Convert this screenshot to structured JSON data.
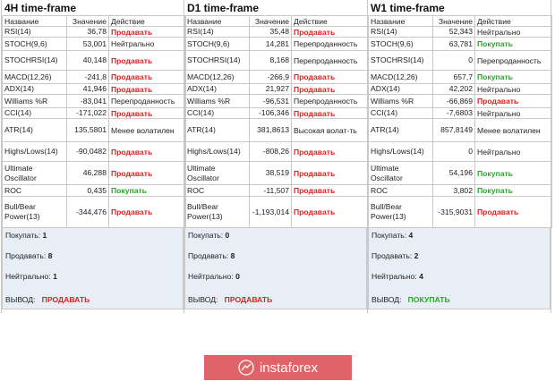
{
  "frames": [
    {
      "title": "4H time-frame",
      "headers": {
        "name": "Название",
        "value": "Значение",
        "action": "Действие"
      },
      "rows": [
        {
          "name": "RSI(14)",
          "value": "36,78",
          "action": "Продавать",
          "type": "sell"
        },
        {
          "name": "STOCH(9,6)",
          "value": "53,001",
          "action": "Нейтрально",
          "type": "neutral"
        },
        {
          "name": "STOCHRSI(14)",
          "value": "40,148",
          "action": "Продавать",
          "type": "sell"
        },
        {
          "name": "MACD(12,26)",
          "value": "-241,8",
          "action": "Продавать",
          "type": "sell"
        },
        {
          "name": "ADX(14)",
          "value": "41,946",
          "action": "Продавать",
          "type": "sell"
        },
        {
          "name": "Williams %R",
          "value": "-83,041",
          "action": "Перепроданность",
          "type": "neutral"
        },
        {
          "name": "CCI(14)",
          "value": "-171,022",
          "action": "Продавать",
          "type": "sell"
        },
        {
          "name": "ATR(14)",
          "value": "135,5801",
          "action": "Менее волатилен",
          "type": "neutral"
        },
        {
          "name": "Highs/Lows(14)",
          "value": "-90,0482",
          "action": "Продавать",
          "type": "sell"
        },
        {
          "name": "Ultimate Oscillator",
          "value": "46,288",
          "action": "Продавать",
          "type": "sell"
        },
        {
          "name": "ROC",
          "value": "0,435",
          "action": "Покупать",
          "type": "buy"
        },
        {
          "name": "Bull/Bear Power(13)",
          "value": "-344,476",
          "action": "Продавать",
          "type": "sell"
        }
      ],
      "summary": {
        "buy_label": "Покупать:",
        "buy": "1",
        "sell_label": "Продавать:",
        "sell": "8",
        "neutral_label": "Нейтрально:",
        "neutral": "1",
        "verdict_label": "ВЫВОД:",
        "verdict": "ПРОДАВАТЬ",
        "verdict_type": "sell"
      }
    },
    {
      "title": "D1 time-frame",
      "headers": {
        "name": "Название",
        "value": "Значение",
        "action": "Действие"
      },
      "rows": [
        {
          "name": "RSI(14)",
          "value": "35,48",
          "action": "Продавать",
          "type": "sell"
        },
        {
          "name": "STOCH(9,6)",
          "value": "14,281",
          "action": "Перепроданность",
          "type": "neutral"
        },
        {
          "name": "STOCHRSI(14)",
          "value": "8,168",
          "action": "Перепроданность",
          "type": "neutral"
        },
        {
          "name": "MACD(12,26)",
          "value": "-266,9",
          "action": "Продавать",
          "type": "sell"
        },
        {
          "name": "ADX(14)",
          "value": "21,927",
          "action": "Продавать",
          "type": "sell"
        },
        {
          "name": "Williams %R",
          "value": "-96,531",
          "action": "Перепроданность",
          "type": "neutral"
        },
        {
          "name": "CCI(14)",
          "value": "-106,346",
          "action": "Продавать",
          "type": "sell"
        },
        {
          "name": "ATR(14)",
          "value": "381,8613",
          "action": "Высокая волат-ть",
          "type": "neutral"
        },
        {
          "name": "Highs/Lows(14)",
          "value": "-808,26",
          "action": "Продавать",
          "type": "sell"
        },
        {
          "name": "Ultimate Oscillator",
          "value": "38,519",
          "action": "Продавать",
          "type": "sell"
        },
        {
          "name": "ROC",
          "value": "-11,507",
          "action": "Продавать",
          "type": "sell"
        },
        {
          "name": "Bull/Bear Power(13)",
          "value": "-1,193,014",
          "action": "Продавать",
          "type": "sell"
        }
      ],
      "summary": {
        "buy_label": "Покупать:",
        "buy": "0",
        "sell_label": "Продавать:",
        "sell": "8",
        "neutral_label": "Нейтрально:",
        "neutral": "0",
        "verdict_label": "ВЫВОД:",
        "verdict": "ПРОДАВАТЬ",
        "verdict_type": "sell"
      }
    },
    {
      "title": "W1 time-frame",
      "headers": {
        "name": "Название",
        "value": "Значение",
        "action": "Действие"
      },
      "rows": [
        {
          "name": "RSI(14)",
          "value": "52,343",
          "action": "Нейтрально",
          "type": "neutral"
        },
        {
          "name": "STOCH(9,6)",
          "value": "63,781",
          "action": "Покупать",
          "type": "buy"
        },
        {
          "name": "STOCHRSI(14)",
          "value": "0",
          "action": "Перепроданность",
          "type": "neutral"
        },
        {
          "name": "MACD(12,26)",
          "value": "657,7",
          "action": "Покупать",
          "type": "buy"
        },
        {
          "name": "ADX(14)",
          "value": "42,202",
          "action": "Нейтрально",
          "type": "neutral"
        },
        {
          "name": "Williams %R",
          "value": "-66,869",
          "action": "Продавать",
          "type": "sell"
        },
        {
          "name": "CCI(14)",
          "value": "-7,6803",
          "action": "Нейтрально",
          "type": "neutral"
        },
        {
          "name": "ATR(14)",
          "value": "857,8149",
          "action": "Менее волатилен",
          "type": "neutral"
        },
        {
          "name": "Highs/Lows(14)",
          "value": "0",
          "action": "Нейтрально",
          "type": "neutral"
        },
        {
          "name": "Ultimate Oscillator",
          "value": "54,196",
          "action": "Покупать",
          "type": "buy"
        },
        {
          "name": "ROC",
          "value": "3,802",
          "action": "Покупать",
          "type": "buy"
        },
        {
          "name": "Bull/Bear Power(13)",
          "value": "-315,9031",
          "action": "Продавать",
          "type": "sell"
        }
      ],
      "summary": {
        "buy_label": "Покупать:",
        "buy": "4",
        "sell_label": "Продавать:",
        "sell": "2",
        "neutral_label": "Нейтрально:",
        "neutral": "4",
        "verdict_label": "ВЫВОД:",
        "verdict": "ПОКУПАТЬ",
        "verdict_type": "buy"
      }
    }
  ],
  "logo": {
    "text": "instaforex",
    "icon": "instaforex-logo-icon",
    "bg_color": "#e0636a"
  },
  "colors": {
    "sell": "#e02020",
    "buy": "#2aa52a",
    "summary_bg": "#e8eef5"
  }
}
